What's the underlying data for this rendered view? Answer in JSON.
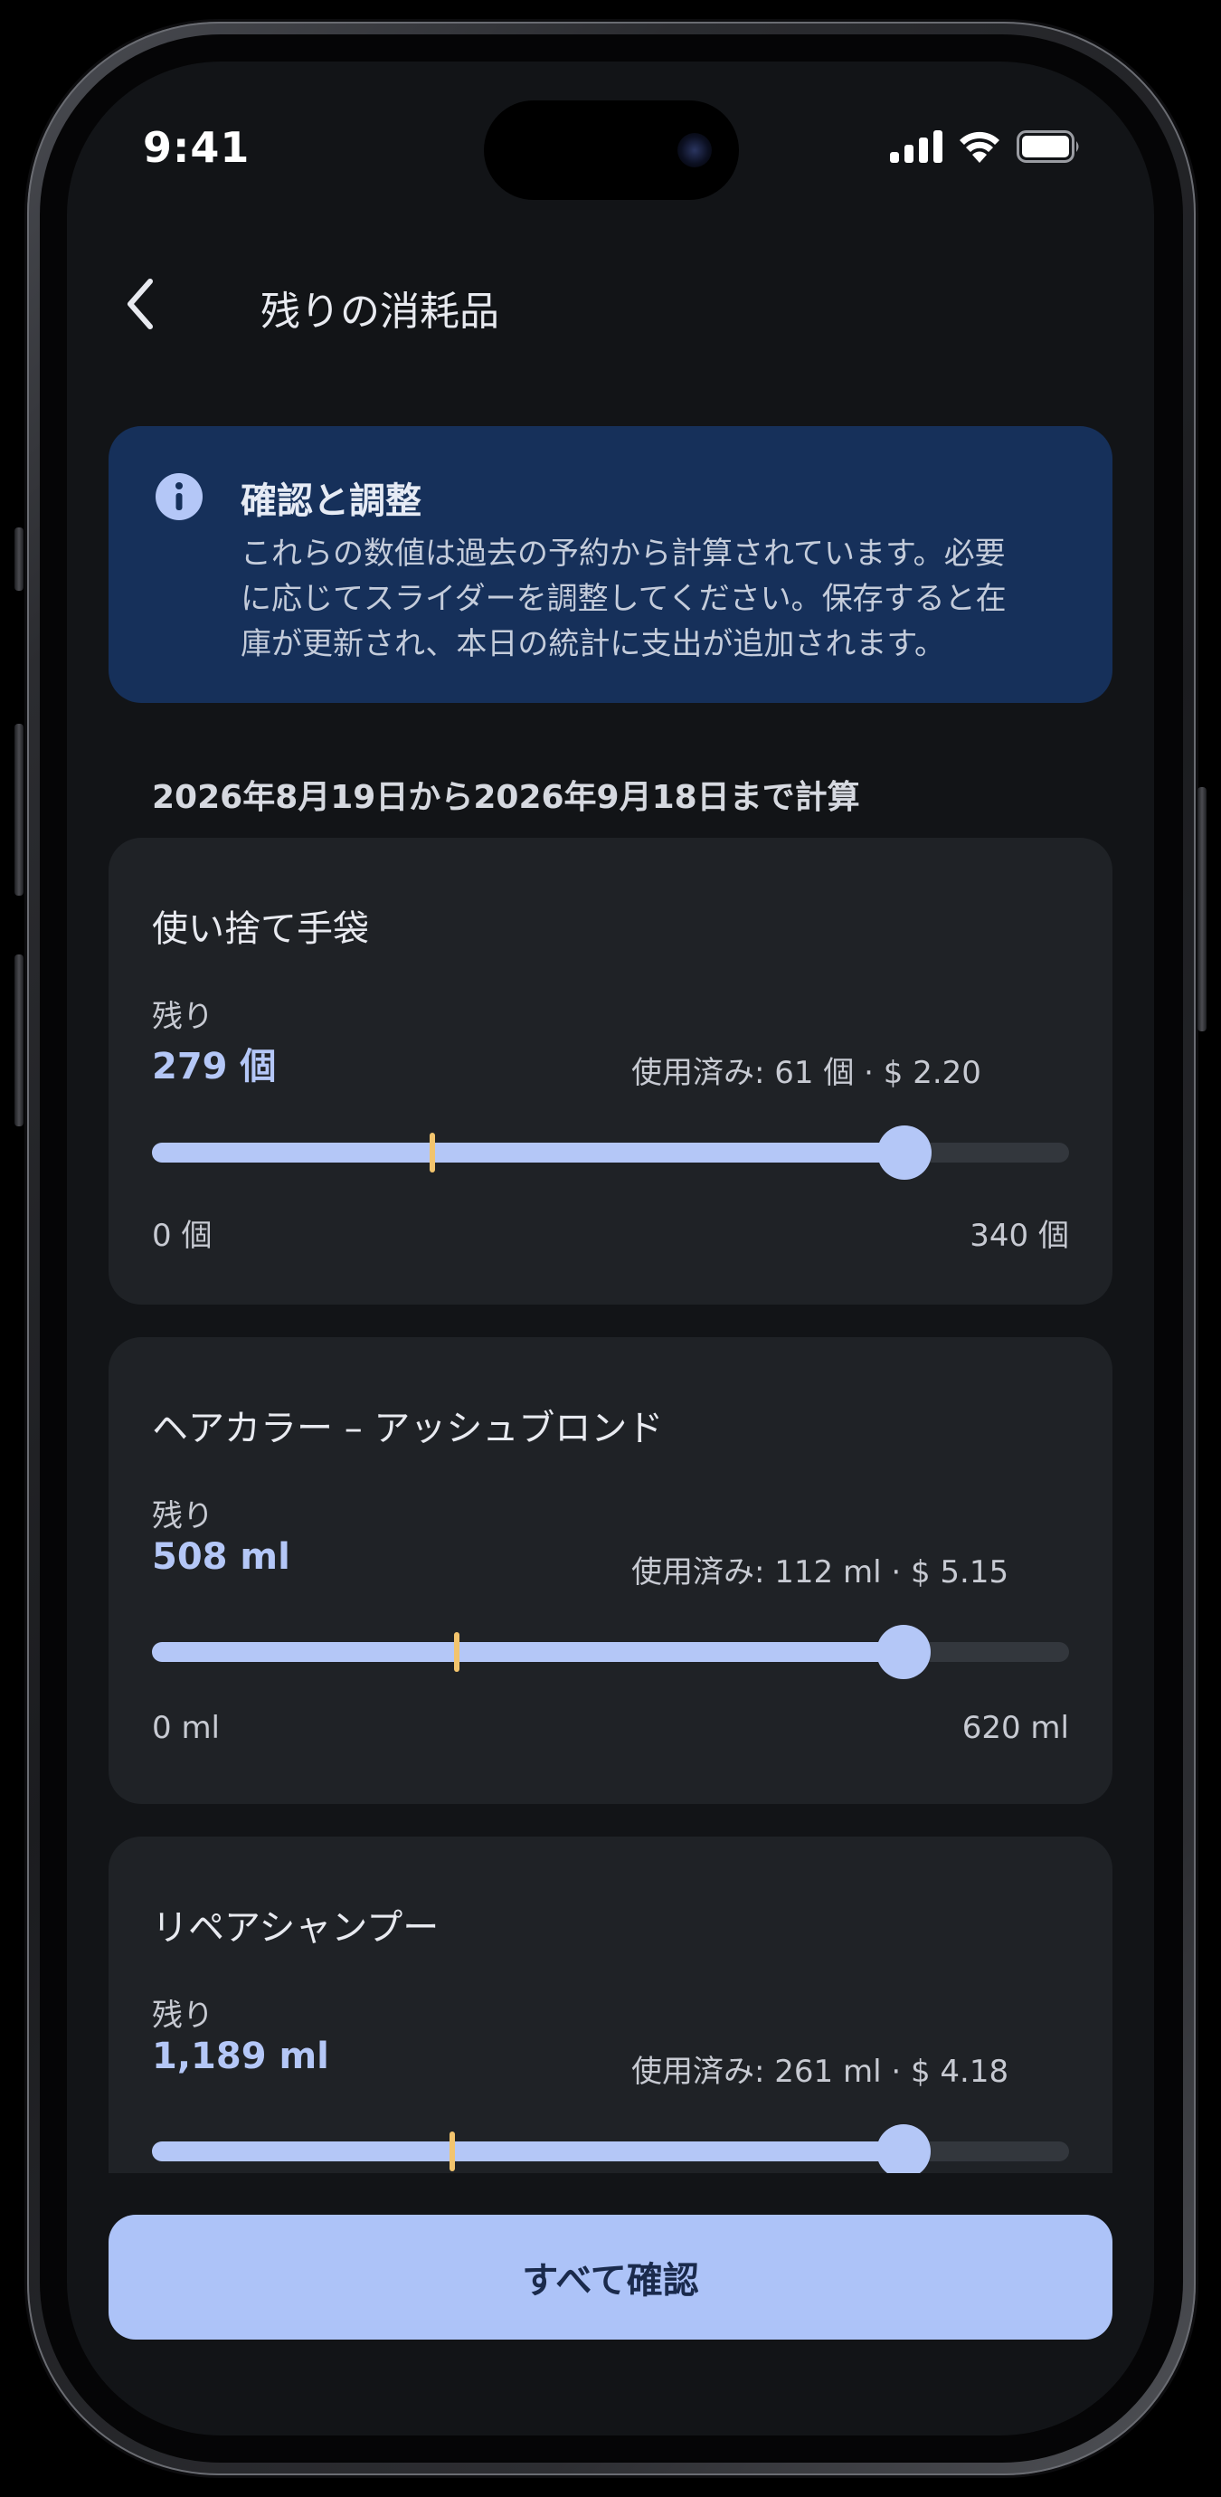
{
  "status_bar": {
    "time": "9:41",
    "icons": [
      "cellular-signal-icon",
      "wifi-icon",
      "battery-icon"
    ]
  },
  "header": {
    "back_icon": "chevron-left-icon",
    "title": "残りの消耗品"
  },
  "info_banner": {
    "icon": "info-icon",
    "title": "確認と調整",
    "body_lines": [
      "これらの数値は過去の予約から計算されています。必要",
      "に応じてスライダーを調整してください。保存すると在",
      "庫が更新され、本日の統計に支出が追加されます。"
    ]
  },
  "range_label": "2026年8月19日から2026年9月18日まで計算",
  "items": [
    {
      "name": "使い捨て手袋",
      "remaining_label": "残り",
      "remaining_display": "279 個",
      "used_display": "使用済み: 61 個 · $ 2.20",
      "min_label": "0 個",
      "max_label": "340 個",
      "slider": {
        "min": 0,
        "max": 340,
        "value": 279,
        "marker": 104
      }
    },
    {
      "name": "ヘアカラー – アッシュブロンド",
      "remaining_label": "残り",
      "remaining_display": "508 ml",
      "used_display": "使用済み: 112 ml · $ 5.15",
      "min_label": "0 ml",
      "max_label": "620 ml",
      "slider": {
        "min": 0,
        "max": 620,
        "value": 508,
        "marker": 206
      }
    },
    {
      "name": "リペアシャンプー",
      "remaining_label": "残り",
      "remaining_display": "1,189 ml",
      "used_display": "使用済み: 261 ml · $ 4.18",
      "min_label": "",
      "max_label": "",
      "slider": {
        "min": 0,
        "max": 1450,
        "value": 1189,
        "marker": 475
      }
    }
  ],
  "confirm_button": {
    "label": "すべて確認"
  },
  "colors": {
    "background": "#121417",
    "card": "#1f2226",
    "banner": "#16305a",
    "accent": "#b4c7f7",
    "marker": "#f2c46d",
    "button": "#adc3f8"
  }
}
